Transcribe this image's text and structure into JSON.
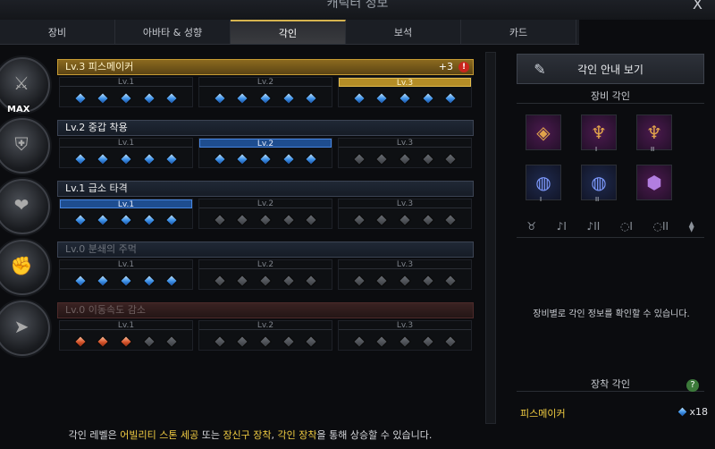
{
  "window": {
    "title": "캐릭터 정보",
    "close_label": "X"
  },
  "tabs": [
    {
      "label": "장비",
      "active": false
    },
    {
      "label": "아바타 & 성향",
      "active": false
    },
    {
      "label": "각인",
      "active": true
    },
    {
      "label": "보석",
      "active": false
    },
    {
      "label": "카드",
      "active": false
    }
  ],
  "engravings": [
    {
      "name": "Lv.3 피스메이커",
      "extra": "+3",
      "warning": "!",
      "emblem_badge": "MAX",
      "gem_color": "blue",
      "filled": 15,
      "highlight_level": 3,
      "style": "gold",
      "levels": [
        "Lv.1",
        "Lv.2",
        "Lv.3"
      ]
    },
    {
      "name": "Lv.2 중갑 착용",
      "gem_color": "blue",
      "filled": 10,
      "highlight_level": 2,
      "style": "normal",
      "levels": [
        "Lv.1",
        "Lv.2",
        "Lv.3"
      ]
    },
    {
      "name": "Lv.1 급소 타격",
      "gem_color": "blue",
      "filled": 5,
      "highlight_level": 1,
      "style": "normal",
      "levels": [
        "Lv.1",
        "Lv.2",
        "Lv.3"
      ]
    },
    {
      "name": "Lv.0 분쇄의 주먹",
      "gem_color": "blue",
      "filled": 5,
      "highlight_level": 0,
      "style": "dim",
      "levels": [
        "Lv.1",
        "Lv.2",
        "Lv.3"
      ]
    },
    {
      "name": "Lv.0 이동속도 감소",
      "gem_color": "red",
      "filled": 3,
      "highlight_level": 0,
      "style": "red",
      "levels": [
        "Lv.1",
        "Lv.2",
        "Lv.3"
      ]
    }
  ],
  "bottom_note": {
    "pre": "각인 레벨은 ",
    "y1": "어빌리티 스톤 세공",
    "mid1": " 또는 ",
    "y2": "장신구 장착",
    "mid2": ", ",
    "y3": "각인 장착",
    "post": "을 통해 상승할 수 있습니다."
  },
  "right_panel": {
    "guide_button": "각인 안내 보기",
    "equip_title": "장비 각인",
    "equip_items": [
      {
        "icon": "necklace-icon",
        "glyph": "◈",
        "sub": ""
      },
      {
        "icon": "earring-icon",
        "glyph": "♆",
        "sub": "I"
      },
      {
        "icon": "earring-icon",
        "glyph": "♆",
        "sub": "II"
      },
      {
        "icon": "ring-icon",
        "glyph": "◍",
        "sub": "I"
      },
      {
        "icon": "ring-icon",
        "glyph": "◍",
        "sub": "II"
      },
      {
        "icon": "stone-icon",
        "glyph": "⬢",
        "sub": ""
      }
    ],
    "slot_icons": [
      "♉",
      "♪I",
      "♪II",
      "◌I",
      "◌II",
      "⧫"
    ],
    "hint": "장비별로 각인 정보를 확인할 수 있습니다.",
    "equipped_title": "장착 각인",
    "help_icon": "?",
    "equipped": {
      "name": "피스메이커",
      "count": "x18"
    }
  }
}
